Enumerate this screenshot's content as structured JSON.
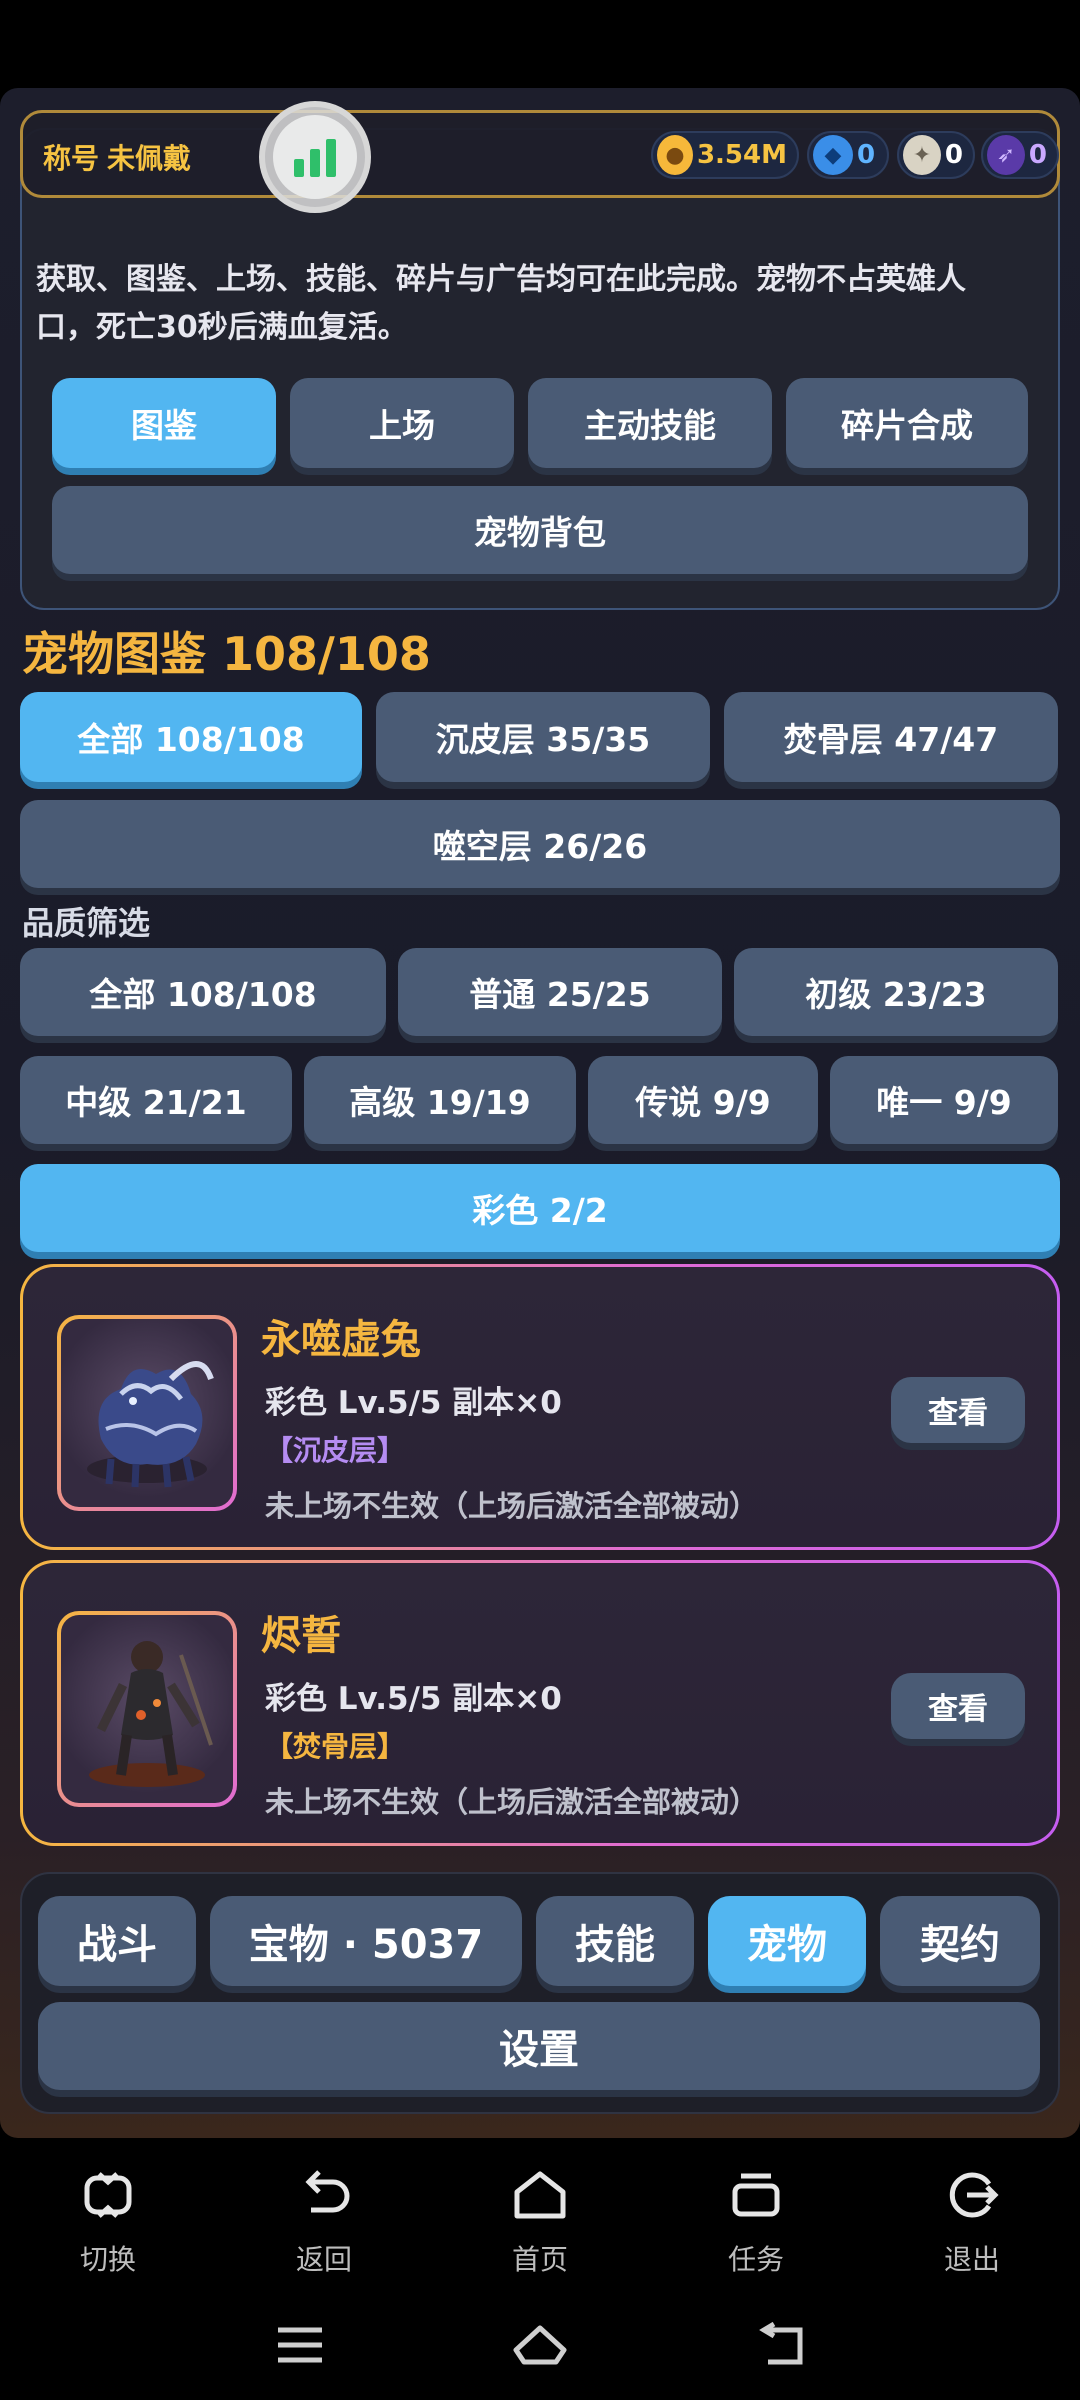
{
  "topbar": {
    "title_label": "称号",
    "title_value": "未佩戴",
    "currencies": [
      {
        "icon": "gold-coin-icon",
        "value": "3.54M",
        "color": "#f6b83a"
      },
      {
        "icon": "blue-gem-icon",
        "value": "0",
        "color": "#3a8ee8"
      },
      {
        "icon": "white-crystal-icon",
        "value": "0",
        "color": "#d9d3c4"
      },
      {
        "icon": "purple-feather-icon",
        "value": "0",
        "color": "#8f63e8"
      }
    ]
  },
  "intro": {
    "text": "获取、图鉴、上场、技能、碎片与广告均可在此完成。宠物不占英雄人口，死亡30秒后满血复活。"
  },
  "pet_tabs": [
    "图鉴",
    "上场",
    "主动技能",
    "碎片合成",
    "宠物背包"
  ],
  "pet_tabs_active": "图鉴",
  "codex": {
    "title": "宠物图鉴 108/108",
    "layers": [
      "全部 108/108",
      "沉皮层 35/35",
      "焚骨层 47/47",
      "噬空层 26/26"
    ],
    "filter_label": "品质筛选",
    "qualities": [
      "全部 108/108",
      "普通 25/25",
      "初级 23/23",
      "中级 21/21",
      "高级 19/19",
      "传说 9/9",
      "唯一 9/9",
      "彩色 2/2"
    ],
    "active_quality": "彩色 2/2"
  },
  "pets": [
    {
      "name": "永噬虚兔",
      "meta": "彩色  Lv.5/5  副本×0",
      "layer": "【沉皮层】",
      "layer_color": "#b58cf2",
      "note": "未上场不生效（上场后激活全部被动）",
      "view": "查看"
    },
    {
      "name": "烬誓",
      "meta": "彩色  Lv.5/5  副本×0",
      "layer": "【焚骨层】",
      "layer_color": "#f5b640",
      "note": "未上场不生效（上场后激活全部被动）",
      "view": "查看"
    }
  ],
  "bottom_tabs": [
    "战斗",
    "宝物 · 5037",
    "技能",
    "宠物",
    "契约",
    "设置"
  ],
  "bottom_tabs_active": "宠物",
  "system_nav": [
    "切换",
    "返回",
    "首页",
    "任务",
    "退出"
  ],
  "colors": {
    "accent": "#52b6f1",
    "gold": "#f5b640",
    "button": "#4a5b75"
  }
}
